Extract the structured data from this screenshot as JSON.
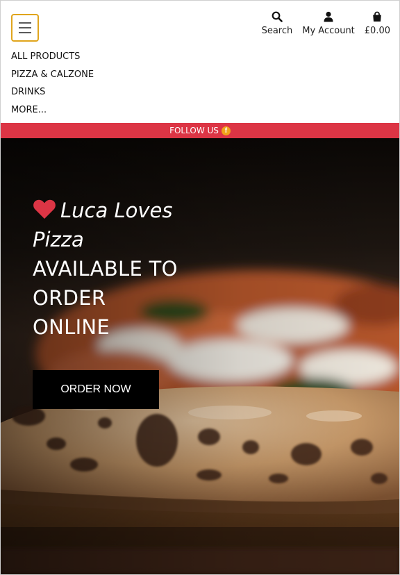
{
  "header": {
    "menu_icon": "hamburger-menu-icon",
    "tools": [
      {
        "icon": "search-icon",
        "label": "Search"
      },
      {
        "icon": "user-icon",
        "label": "My Account"
      },
      {
        "icon": "shopping-bag-icon",
        "label": "£0.00"
      }
    ],
    "accent_color": "#e0a51c"
  },
  "nav": {
    "items": [
      "ALL PRODUCTS",
      "PIZZA & CALZONE",
      "DRINKS",
      "MORE..."
    ]
  },
  "follow_bar": {
    "text": "FOLLOW US",
    "icon": "facebook-icon",
    "icon_letter": "f",
    "background": "#dc3545"
  },
  "hero": {
    "brand_line_1": "Luca Loves",
    "brand_line_2": "Pizza",
    "tagline_lines": [
      "AVAILABLE TO",
      "ORDER",
      "ONLINE"
    ],
    "button_label": "ORDER NOW",
    "heart_color": "#dc3545"
  }
}
